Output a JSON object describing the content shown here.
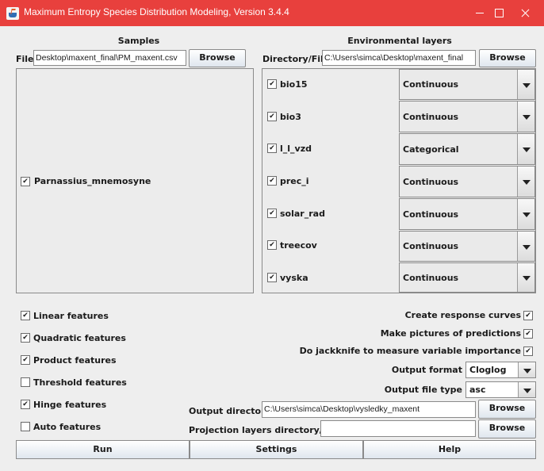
{
  "window": {
    "title": "Maximum Entropy Species Distribution Modeling, Version 3.4.4"
  },
  "samples": {
    "header": "Samples",
    "file_label": "File",
    "file_value": "Desktop\\maxent_final\\PM_maxent.csv",
    "browse_label": "Browse",
    "species": [
      {
        "name": "Parnassius_mnemosyne",
        "checked": true
      }
    ]
  },
  "env": {
    "header": "Environmental layers",
    "dir_label": "Directory/File",
    "dir_value": "C:\\Users\\simca\\Desktop\\maxent_final",
    "browse_label": "Browse",
    "layers": [
      {
        "name": "bio15",
        "type": "Continuous",
        "checked": true
      },
      {
        "name": "bio3",
        "type": "Continuous",
        "checked": true
      },
      {
        "name": "l_l_vzd",
        "type": "Categorical",
        "checked": true
      },
      {
        "name": "prec_i",
        "type": "Continuous",
        "checked": true
      },
      {
        "name": "solar_rad",
        "type": "Continuous",
        "checked": true
      },
      {
        "name": "treecov",
        "type": "Continuous",
        "checked": true
      },
      {
        "name": "vyska",
        "type": "Continuous",
        "checked": true
      }
    ]
  },
  "features": [
    {
      "label": "Linear features",
      "checked": true
    },
    {
      "label": "Quadratic features",
      "checked": true
    },
    {
      "label": "Product features",
      "checked": true
    },
    {
      "label": "Threshold features",
      "checked": false
    },
    {
      "label": "Hinge features",
      "checked": true
    },
    {
      "label": "Auto features",
      "checked": false
    }
  ],
  "options": {
    "response_curves": {
      "label": "Create response curves",
      "checked": true
    },
    "pictures": {
      "label": "Make pictures of predictions",
      "checked": true
    },
    "jackknife": {
      "label": "Do jackknife to measure variable importance",
      "checked": true
    },
    "output_format_label": "Output format",
    "output_format": "Cloglog",
    "output_type_label": "Output file type",
    "output_type": "asc",
    "output_dir_label": "Output directory",
    "output_dir": "C:\\Users\\simca\\Desktop\\vysledky_maxent",
    "projection_label": "Projection layers directory/file",
    "projection_value": "",
    "browse_label": "Browse"
  },
  "bottom": {
    "run": "Run",
    "settings": "Settings",
    "help": "Help"
  }
}
